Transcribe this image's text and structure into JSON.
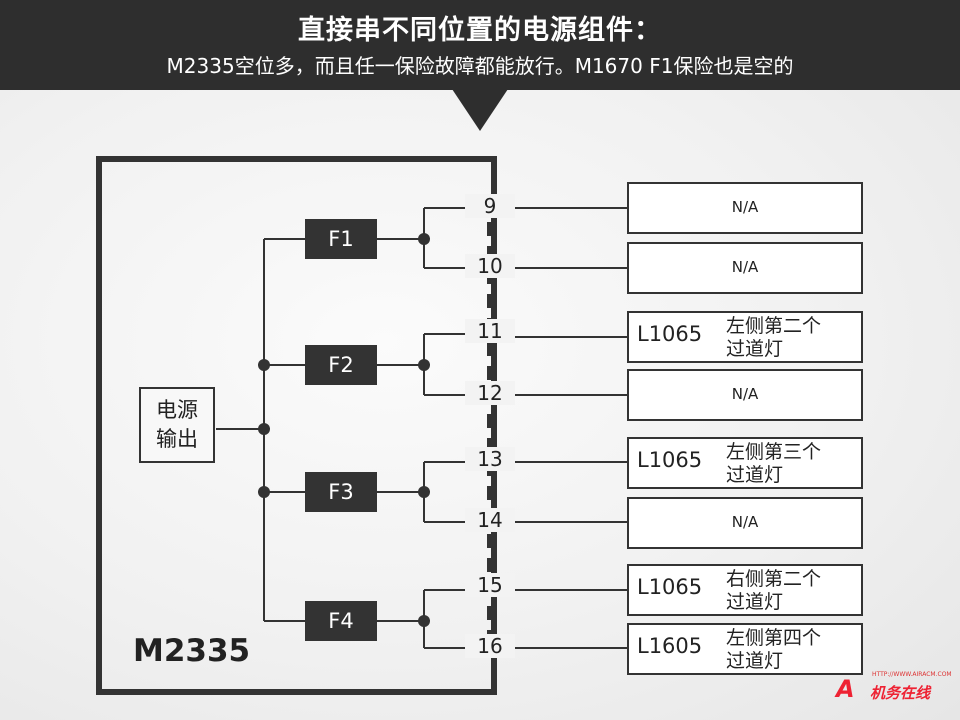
{
  "header": {
    "title": "直接串不同位置的电源组件：",
    "subtitle": "M2335空位多，而且任一保险故障都能放行。M1670 F1保险也是空的"
  },
  "diagram": {
    "model": "M2335",
    "source": {
      "line1": "电源",
      "line2": "输出"
    },
    "fuses": [
      "F1",
      "F2",
      "F3",
      "F4"
    ],
    "pins": [
      "9",
      "10",
      "11",
      "12",
      "13",
      "14",
      "15",
      "16"
    ],
    "loads": [
      {
        "pin": "9",
        "na": "N/A"
      },
      {
        "pin": "10",
        "na": "N/A"
      },
      {
        "pin": "11",
        "code": "L1065",
        "line1": "左侧第二个",
        "line2": "过道灯"
      },
      {
        "pin": "12",
        "na": "N/A"
      },
      {
        "pin": "13",
        "code": "L1065",
        "line1": "左侧第三个",
        "line2": "过道灯"
      },
      {
        "pin": "14",
        "na": "N/A"
      },
      {
        "pin": "15",
        "code": "L1065",
        "line1": "右侧第二个",
        "line2": "过道灯"
      },
      {
        "pin": "16",
        "code": "L1605",
        "line1": "左侧第四个",
        "line2": "过道灯"
      }
    ]
  },
  "watermark": {
    "url": "HTTP://WWW.AIRACM.COM",
    "text": "机务在线"
  },
  "colors": {
    "banner": "#2e2e2e",
    "fuse": "#333333",
    "line": "#333333",
    "logo": "#e22233"
  }
}
